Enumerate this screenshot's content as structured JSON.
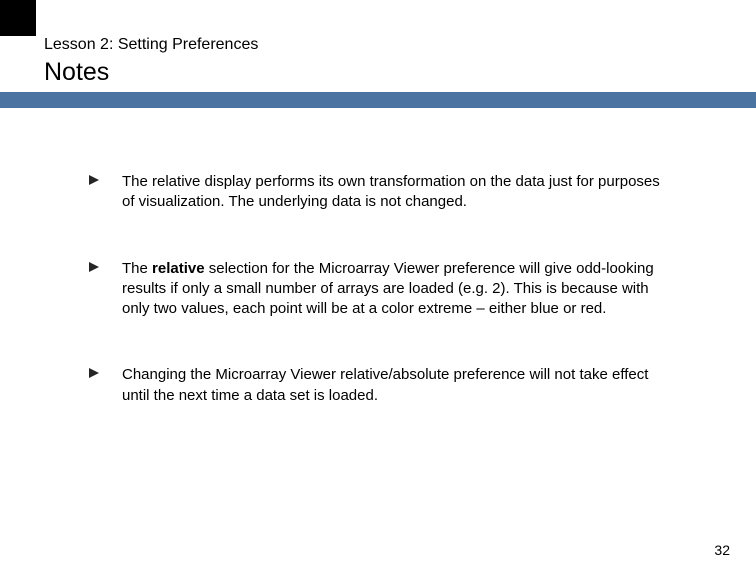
{
  "header": {
    "lesson_label": "Lesson 2: Setting Preferences",
    "title": "Notes"
  },
  "bullets": [
    {
      "text": "The relative display performs its own transformation on the data just for purposes of visualization.  The underlying data is not changed."
    },
    {
      "prefix": "The ",
      "bold": "relative",
      "suffix": " selection for the Microarray Viewer preference will give odd-looking results if only a small number of arrays are loaded (e.g. 2).  This is because with only two values, each point will be at a color extreme – either blue or red."
    },
    {
      "text": "Changing the Microarray Viewer relative/absolute preference  will not take effect until the next time a data set is loaded."
    }
  ],
  "page_number": "32"
}
